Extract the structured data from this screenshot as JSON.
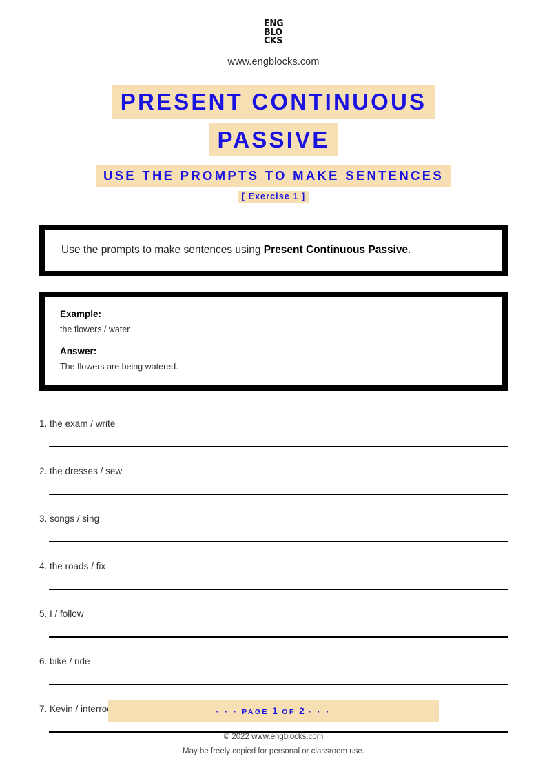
{
  "header": {
    "logo_lines": [
      "ENG",
      "BLO",
      "CKS"
    ],
    "site_url": "www.engblocks.com"
  },
  "title": {
    "line1": "PRESENT CONTINUOUS",
    "line2": "PASSIVE",
    "subtitle": "USE THE PROMPTS TO MAKE SENTENCES",
    "exercise_label": "[ Exercise 1 ]",
    "accent_color": "#1A12E0",
    "highlight_color": "#F5DFB3"
  },
  "instruction": {
    "prefix": "Use the prompts to make sentences using ",
    "emphasis": "Present Continuous Passive",
    "suffix": "."
  },
  "example": {
    "example_label": "Example:",
    "prompt": "the flowers / water",
    "answer_label": "Answer:",
    "answer": "The flowers are being watered."
  },
  "exercises": [
    {
      "number": "1.",
      "prompt": "the exam / write"
    },
    {
      "number": "2.",
      "prompt": "the dresses / sew"
    },
    {
      "number": "3.",
      "prompt": "songs / sing"
    },
    {
      "number": "4.",
      "prompt": "the roads / fix"
    },
    {
      "number": "5.",
      "prompt": "I / follow"
    },
    {
      "number": "6.",
      "prompt": "bike / ride"
    },
    {
      "number": "7.",
      "prompt": "Kevin / interrogate"
    }
  ],
  "footer": {
    "dots_left": "·  ·  ·",
    "page_word": "PAGE",
    "current_page": "1",
    "of_word": "OF",
    "total_pages": "2",
    "dots_right": "·  ·  ·",
    "copyright": "© 2022 www.engblocks.com",
    "license": "May be freely copied for personal or classroom use."
  }
}
